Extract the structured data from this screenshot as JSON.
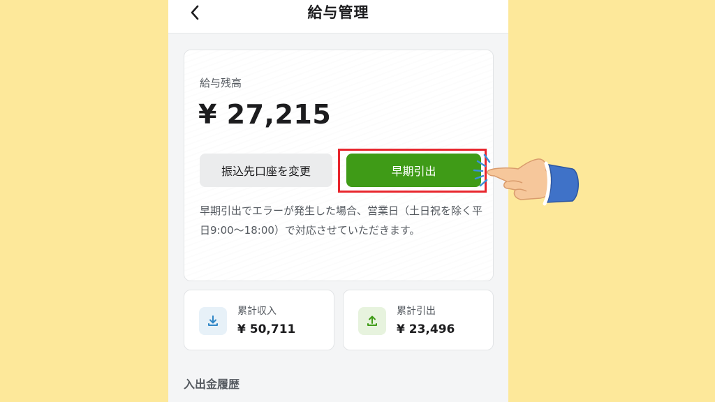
{
  "header": {
    "title": "給与管理",
    "back_icon": "chevron-left-icon"
  },
  "balance": {
    "label": "給与残高",
    "amount": "¥ 27,215",
    "change_account_label": "振込先口座を変更",
    "early_withdraw_label": "早期引出",
    "notice": "早期引出でエラーが発生した場合、営業日（土日祝を除く平日9:00〜18:00）で対応させていただきます。"
  },
  "stats": {
    "income": {
      "label": "累計収入",
      "value": "¥ 50,711",
      "icon": "download-icon",
      "color": "#2f86c6"
    },
    "withdraw": {
      "label": "累計引出",
      "value": "¥ 23,496",
      "icon": "upload-icon",
      "color": "#3f9b17"
    }
  },
  "history": {
    "title": "入出金履歴"
  },
  "colors": {
    "background": "#fde89a",
    "accent_green": "#3f9b17",
    "highlight_red": "#e8262d"
  }
}
